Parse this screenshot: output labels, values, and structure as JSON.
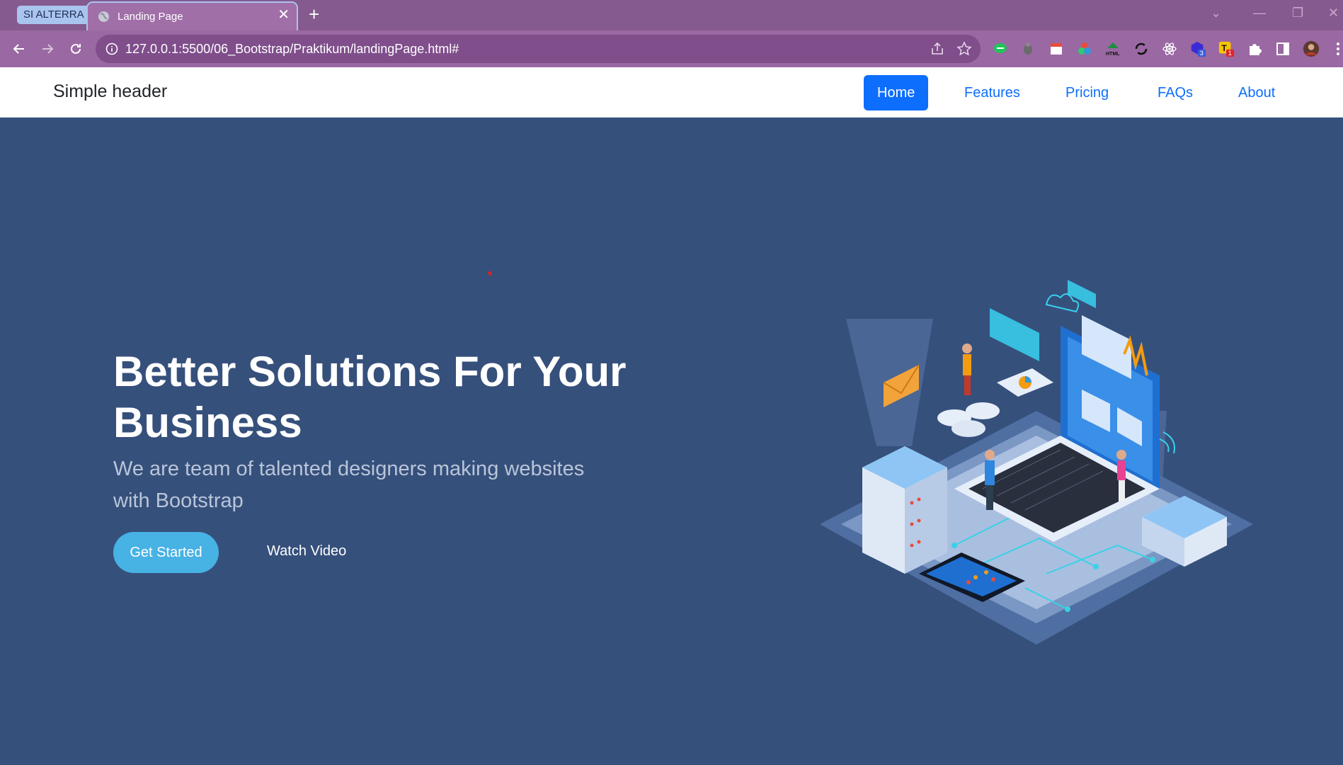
{
  "browser": {
    "tab_group_label": "SI ALTERRA",
    "tab_title": "Landing Page",
    "url": "127.0.0.1:5500/06_Bootstrap/Praktikum/landingPage.html#",
    "extensions": [
      {
        "name": "chat-extension-icon"
      },
      {
        "name": "bug-extension-icon"
      },
      {
        "name": "calendar-extension-icon"
      },
      {
        "name": "color-picker-extension-icon"
      },
      {
        "name": "html-extension-icon"
      },
      {
        "name": "sync-extension-icon"
      },
      {
        "name": "react-extension-icon"
      },
      {
        "name": "cube-extension-icon",
        "badge": "3"
      },
      {
        "name": "translate-extension-icon",
        "badge": "1"
      },
      {
        "name": "puzzle-extensions-icon"
      }
    ]
  },
  "navbar": {
    "brand": "Simple header",
    "links": [
      {
        "label": "Home",
        "active": true
      },
      {
        "label": "Features",
        "active": false
      },
      {
        "label": "Pricing",
        "active": false
      },
      {
        "label": "FAQs",
        "active": false
      },
      {
        "label": "About",
        "active": false
      }
    ]
  },
  "hero": {
    "title": "Better Solutions For Your Business",
    "subtitle": "We are team of talented designers making websites with Bootstrap",
    "primary_button": "Get Started",
    "secondary_button": "Watch Video"
  },
  "colors": {
    "page_bg": "#36507c",
    "accent": "#47b2e4",
    "nav_active": "#0d6efd",
    "chrome": "#9a68a3"
  }
}
